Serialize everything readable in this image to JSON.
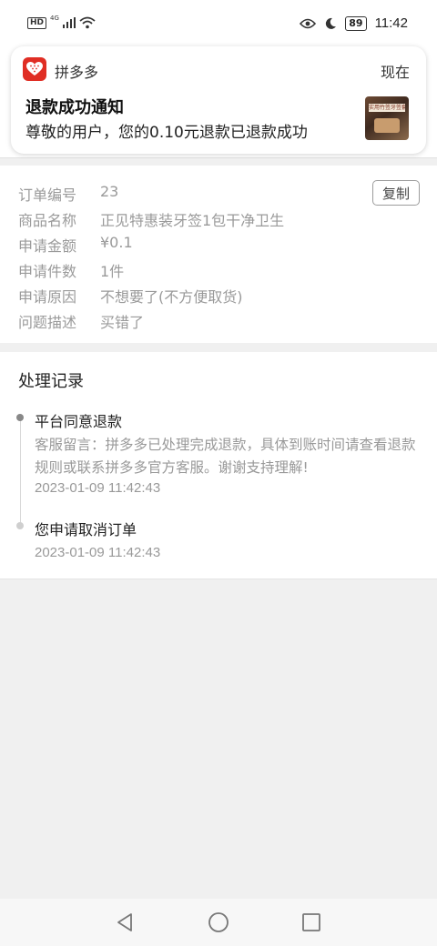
{
  "status_bar": {
    "hd": "HD",
    "network": "4G",
    "battery": "89",
    "time": "11:42"
  },
  "notification": {
    "app_name": "拼多多",
    "time": "现在",
    "title": "退款成功通知",
    "body": "尊敬的用户，您的0.10元退款已退款成功",
    "thumbnail_text": "实用竹签牙签套装",
    "app_icon_color": "#e02e24"
  },
  "order_info": {
    "copy_label": "复制",
    "rows": [
      {
        "label": "订单编号",
        "value": "23"
      },
      {
        "label": "商品名称",
        "value": "正见特惠装牙签1包干净卫生"
      },
      {
        "label": "申请金额",
        "value": "¥0.1"
      },
      {
        "label": "申请件数",
        "value": "1件"
      },
      {
        "label": "申请原因",
        "value": "不想要了(不方便取货)"
      },
      {
        "label": "问题描述",
        "value": "买错了"
      }
    ]
  },
  "records": {
    "title": "处理记录",
    "items": [
      {
        "event": "平台同意退款",
        "message": "客服留言：拼多多已处理完成退款，具体到账时间请查看退款规则或联系拼多多官方客服。谢谢支持理解!",
        "time": "2023-01-09 11:42:43"
      },
      {
        "event": "您申请取消订单",
        "message": "",
        "time": "2023-01-09 11:42:43"
      }
    ]
  },
  "nav_bar": {
    "icons": [
      "back-icon",
      "home-icon",
      "recents-icon"
    ]
  }
}
